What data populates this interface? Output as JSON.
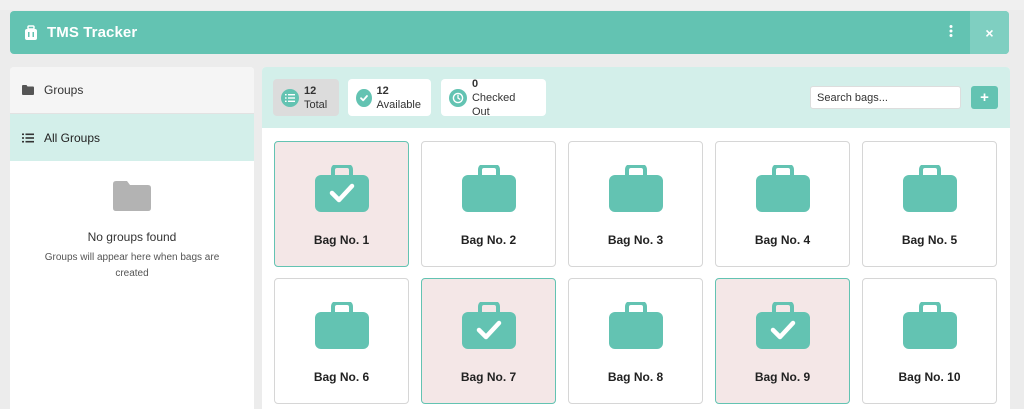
{
  "colors": {
    "accent": "#63c3b2",
    "accent_light": "#d3efea",
    "checked_bg": "#f4e7e7"
  },
  "header": {
    "title": "TMS Tracker",
    "brand_icon": "luggage-icon",
    "menu_icon": "vertical-dots-icon",
    "close_icon": "close-icon",
    "close_label": "×"
  },
  "sidebar": {
    "items": [
      {
        "label": "Groups",
        "icon": "folder-icon"
      },
      {
        "label": "All Groups",
        "icon": "list-icon",
        "active": true
      }
    ],
    "empty": {
      "icon": "folder-icon",
      "title": "No groups found",
      "description": "Groups will appear here when bags are created"
    }
  },
  "toolbar": {
    "stats": [
      {
        "count": "12",
        "label": "Total",
        "icon": "list-icon"
      },
      {
        "count": "12",
        "label": "Available",
        "icon": "check-circle-icon"
      },
      {
        "count": "0",
        "label": "Checked Out",
        "icon": "clock-icon"
      }
    ],
    "search_placeholder": "Search bags...",
    "add_label": "+"
  },
  "bags": [
    {
      "label": "Bag No. 1",
      "checked": true
    },
    {
      "label": "Bag No. 2",
      "checked": false
    },
    {
      "label": "Bag No. 3",
      "checked": false
    },
    {
      "label": "Bag No. 4",
      "checked": false
    },
    {
      "label": "Bag No. 5",
      "checked": false
    },
    {
      "label": "Bag No. 6",
      "checked": false
    },
    {
      "label": "Bag No. 7",
      "checked": true
    },
    {
      "label": "Bag No. 8",
      "checked": false
    },
    {
      "label": "Bag No. 9",
      "checked": true
    },
    {
      "label": "Bag No. 10",
      "checked": false
    }
  ]
}
